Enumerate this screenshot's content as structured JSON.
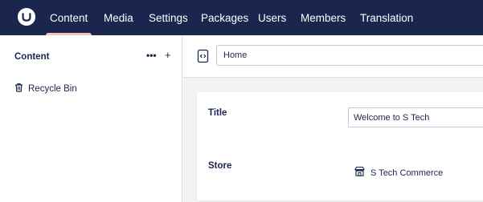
{
  "header": {
    "logo_icon": "umbraco-logo-icon",
    "nav": [
      {
        "label": "Content",
        "active": true
      },
      {
        "label": "Media",
        "active": false
      },
      {
        "label": "Settings",
        "active": false
      },
      {
        "label": "Packages",
        "active": false
      },
      {
        "label": "Users",
        "active": false
      },
      {
        "label": "Members",
        "active": false
      },
      {
        "label": "Translation",
        "active": false
      }
    ]
  },
  "sidebar": {
    "title": "Content",
    "actions_label": "•••",
    "add_label": "+",
    "items": [
      {
        "label": "Recycle Bin",
        "icon": "trash-icon"
      }
    ]
  },
  "editor": {
    "document_icon": "document-code-icon",
    "name_value": "Home",
    "properties": {
      "title_label": "Title",
      "title_value": "Welcome to S Tech",
      "store_label": "Store",
      "store_value": "S Tech Commerce",
      "store_icon": "store-icon"
    }
  },
  "colors": {
    "header_bg": "#1b264f",
    "active_tab_indicator": "#f5c1bc",
    "text_primary": "#1b264f",
    "page_bg": "#f3f3f5"
  }
}
